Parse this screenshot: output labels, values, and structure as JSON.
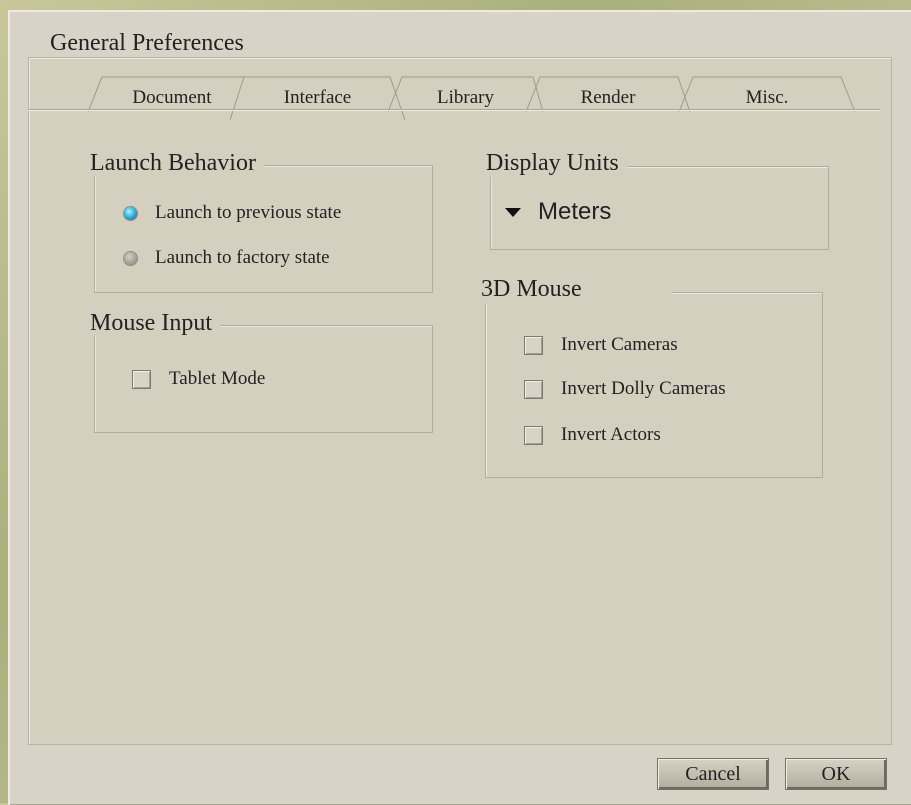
{
  "window": {
    "title": "General Preferences"
  },
  "tabs": [
    "Document",
    "Interface",
    "Library",
    "Render",
    "Misc."
  ],
  "active_tab": "Interface",
  "launch": {
    "legend": "Launch Behavior",
    "options": [
      {
        "label": "Launch to previous state",
        "selected": true
      },
      {
        "label": "Launch to factory state",
        "selected": false
      }
    ]
  },
  "mouse_input": {
    "legend": "Mouse Input",
    "tablet_label": "Tablet Mode"
  },
  "display_units": {
    "legend": "Display Units",
    "value": "Meters"
  },
  "mouse3d": {
    "legend": "3D Mouse",
    "options": [
      "Invert Cameras",
      "Invert Dolly Cameras",
      "Invert Actors"
    ]
  },
  "buttons": {
    "cancel": "Cancel",
    "ok": "OK"
  },
  "colors": {
    "accent_radio": "#2aa7d2",
    "panel": "#d4cfbf"
  }
}
